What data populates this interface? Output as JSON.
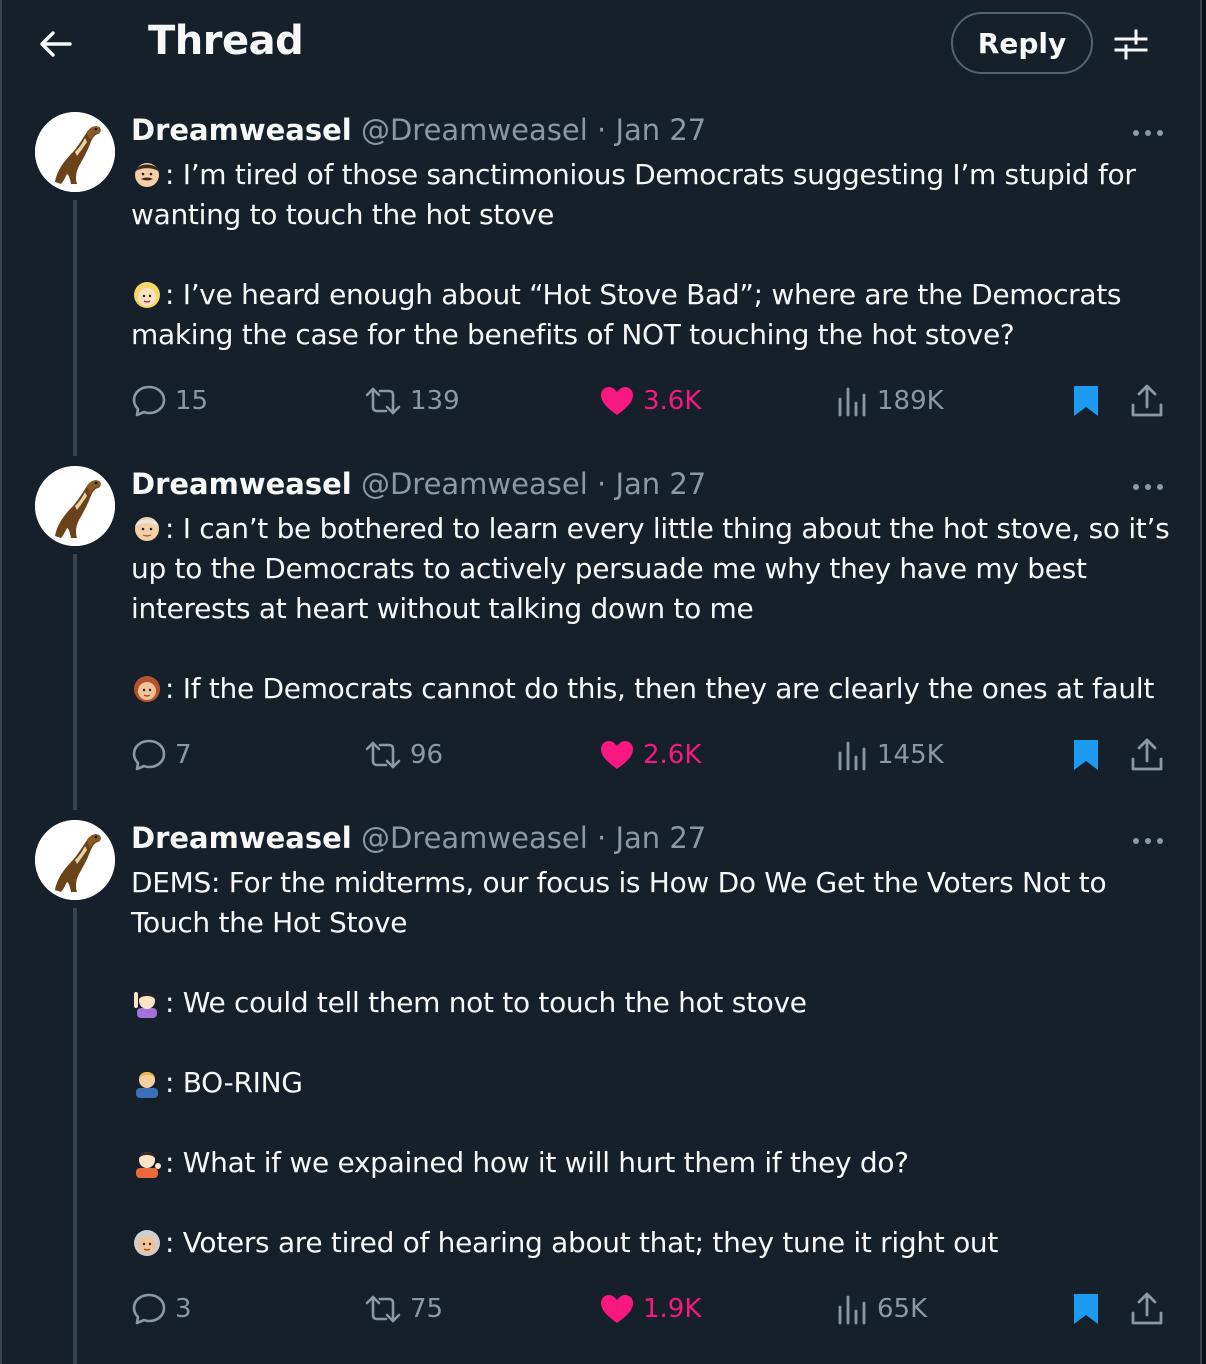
{
  "header": {
    "title": "Thread",
    "reply_label": "Reply",
    "back_icon": "arrow-left-icon",
    "filter_icon": "sliders-icon"
  },
  "colors": {
    "background": "#15202b",
    "like": "#f91880",
    "bookmark": "#1d9bf0",
    "muted": "#8b98a5"
  },
  "tweets": [
    {
      "name": "Dreamweasel",
      "handle": "@Dreamweasel",
      "dot": "·",
      "date": "Jan 27",
      "lines": [
        {
          "emoji": "man-mustache-emoji",
          "text": ": I’m tired of those sanctimonious Democrats suggesting I’m stupid for wanting to touch the hot stove"
        },
        {
          "emoji": "blonde-person-emoji",
          "text": ": I’ve heard enough about “Hot Stove Bad”; where are the Democrats making the case for the benefits of NOT touching the hot stove?"
        }
      ],
      "stats": {
        "replies": "15",
        "retweets": "139",
        "likes": "3.6K",
        "views": "189K"
      }
    },
    {
      "name": "Dreamweasel",
      "handle": "@Dreamweasel",
      "dot": "·",
      "date": "Jan 27",
      "lines": [
        {
          "emoji": "older-man-emoji",
          "text": ": I can’t be bothered to learn every little thing about the hot stove, so it’s up to the Democrats to actively persuade me why they have my best interests at heart without talking down to me"
        },
        {
          "emoji": "woman-red-hair-emoji",
          "text": ": If the Democrats cannot do this, then they are clearly the ones at fault"
        }
      ],
      "stats": {
        "replies": "7",
        "retweets": "96",
        "likes": "2.6K",
        "views": "145K"
      }
    },
    {
      "name": "Dreamweasel",
      "handle": "@Dreamweasel",
      "dot": "·",
      "date": "Jan 27",
      "intro": "DEMS: For the midterms, our focus is How Do We Get the Voters Not to Touch the Hot Stove",
      "lines": [
        {
          "emoji": "person-raising-hand-emoji",
          "text": ": We could tell them not to touch the hot stove"
        },
        {
          "emoji": "man-blond-office-emoji",
          "text": ": BO-RING"
        },
        {
          "emoji": "person-tipping-hand-emoji",
          "text": ": What if we expained how it will hurt them if they do?"
        },
        {
          "emoji": "older-woman-emoji",
          "text": ": Voters are tired of hearing about that; they tune it right out"
        }
      ],
      "stats": {
        "replies": "3",
        "retweets": "75",
        "likes": "1.9K",
        "views": "65K"
      }
    }
  ]
}
